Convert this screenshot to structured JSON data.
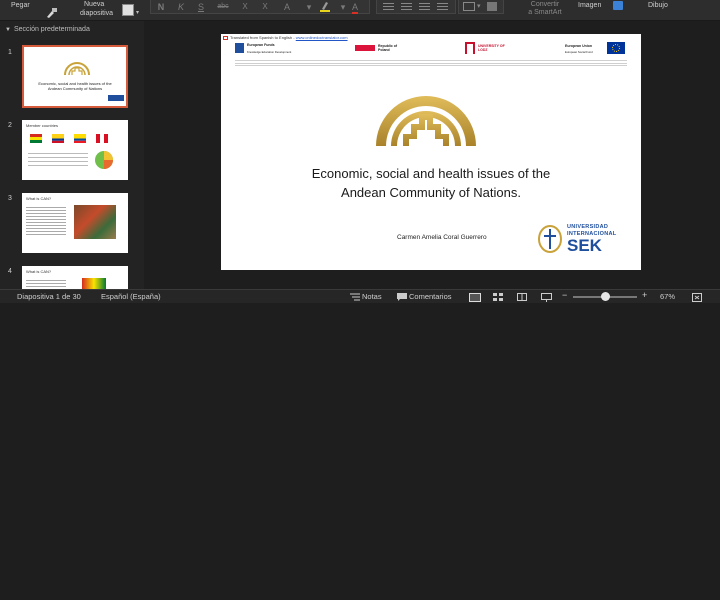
{
  "ribbon": {
    "paste_label": "Pegar",
    "new_slide_label_1": "Nueva",
    "new_slide_label_2": "diapositiva",
    "format_buttons": [
      "N",
      "K",
      "S",
      "abc",
      "X",
      "X",
      "A",
      "A"
    ],
    "convert_label_1": "Convertir",
    "convert_label_2": "a SmartArt",
    "image_label": "Imagen",
    "drawing_label": "Dibujo"
  },
  "sidebar": {
    "section_title": "Sección predeterminada",
    "slides": [
      {
        "number": "1",
        "title": "Economic, social and health issues of the Andean Community of Nations"
      },
      {
        "number": "2",
        "title": "Member countries"
      },
      {
        "number": "3",
        "title": "What is CAN?"
      },
      {
        "number": "4",
        "title": "What is CAN?"
      }
    ]
  },
  "slide": {
    "translated_text": "Translated from Spanish to English -",
    "translated_link": "www.onlinedoctranslator.com",
    "partner_logos": [
      "European Funds",
      "Republic of Poland",
      "UNIVERSITY OF LODZ",
      "European Union"
    ],
    "partner_sub": [
      "Knowledge Education Development",
      "",
      "",
      "European Social Fund"
    ],
    "title_line_1": "Economic, social and health issues of the",
    "title_line_2": "Andean Community of Nations.",
    "author": "Carmen Amelia Coral Guerrero",
    "sek_line_1": "UNIVERSIDAD",
    "sek_line_2": "INTERNACIONAL",
    "sek_big": "SEK"
  },
  "status": {
    "slide_counter": "Diapositiva 1 de 30",
    "language": "Español (España)",
    "notes_label": "Notas",
    "comments_label": "Comentarios",
    "zoom_minus": "−",
    "zoom_plus": "+",
    "zoom": "67%",
    "zoom_level": 0.5
  },
  "colors": {
    "andean_gold": "#c9a33a",
    "selection_border": "#d55b3c",
    "sek_blue": "#1f4e9c"
  }
}
